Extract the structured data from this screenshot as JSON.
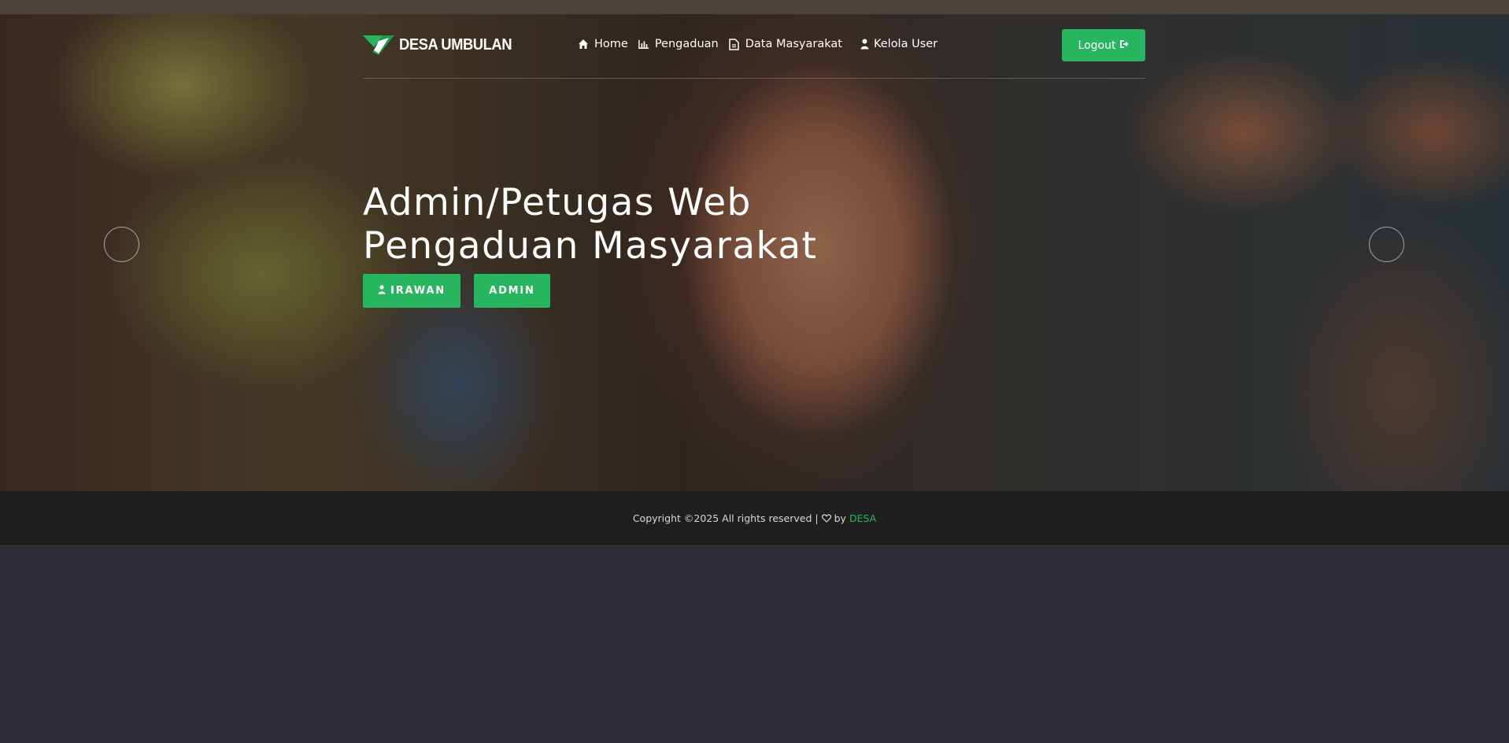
{
  "brand": {
    "name": "DESA UMBULAN",
    "logo_icon": "brand-logo-icon",
    "accent_color": "#28b560"
  },
  "nav": {
    "items": [
      {
        "label": "Home",
        "icon": "home-icon"
      },
      {
        "label": "Pengaduan",
        "icon": "bar-chart-icon"
      },
      {
        "label": "Data Masyarakat",
        "icon": "file-icon"
      },
      {
        "label": "Kelola User",
        "icon": "user-icon"
      }
    ],
    "logout_label": "Logout",
    "logout_icon": "sign-out-icon"
  },
  "hero": {
    "title_line1": "Admin/Petugas Web",
    "title_line2": "Pengaduan Masyarakat",
    "user_button": "IRAWAN",
    "user_button_icon": "user-icon",
    "role_button": "ADMIN",
    "carousel_prev_icon": "arrow-left-circle-icon",
    "carousel_next_icon": "arrow-right-circle-icon"
  },
  "footer": {
    "copyright_text": "Copyright ©2025 All rights reserved |",
    "heart_icon": "heart-icon",
    "by_text": "by",
    "link_text": "DESA"
  }
}
